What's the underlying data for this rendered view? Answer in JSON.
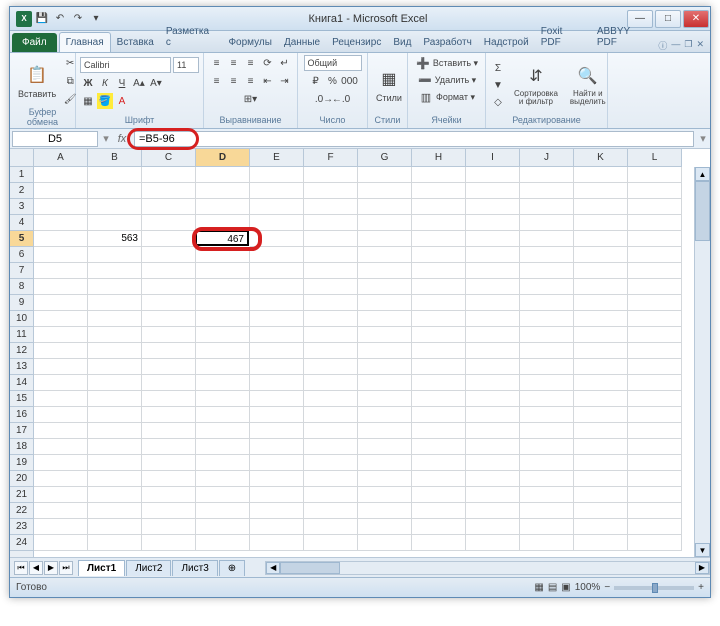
{
  "window": {
    "title": "Книга1 - Microsoft Excel"
  },
  "qat": {
    "save": "💾",
    "undo": "↶",
    "redo": "↷"
  },
  "tabs": {
    "file": "Файл",
    "items": [
      "Главная",
      "Вставка",
      "Разметка с",
      "Формулы",
      "Данные",
      "Рецензирс",
      "Вид",
      "Разработч",
      "Надстрой",
      "Foxit PDF",
      "ABBYY PDF"
    ],
    "active": 0
  },
  "ribbon": {
    "clipboard": {
      "label": "Буфер обмена",
      "paste": "Вставить"
    },
    "font": {
      "label": "Шрифт",
      "name": "Calibri",
      "size": "11"
    },
    "align": {
      "label": "Выравнивание"
    },
    "number": {
      "label": "Число",
      "format": "Общий"
    },
    "styles": {
      "label": "Стили",
      "btn": "Стили"
    },
    "cells": {
      "label": "Ячейки",
      "insert": "Вставить ▾",
      "delete": "Удалить ▾",
      "format": "Формат ▾"
    },
    "editing": {
      "label": "Редактирование",
      "sort": "Сортировка и фильтр",
      "find": "Найти и выделить"
    }
  },
  "formula_bar": {
    "name_box": "D5",
    "fx": "fx",
    "formula": "=B5-96"
  },
  "grid": {
    "cols": [
      "A",
      "B",
      "C",
      "D",
      "E",
      "F",
      "G",
      "H",
      "I",
      "J",
      "K",
      "L"
    ],
    "rows": 24,
    "active_col": 3,
    "active_row": 5,
    "cells": {
      "B5": "563",
      "D5": "467"
    }
  },
  "sheets": {
    "tabs": [
      "Лист1",
      "Лист2",
      "Лист3"
    ],
    "active": 0
  },
  "status": {
    "ready": "Готово",
    "zoom": "100%"
  }
}
